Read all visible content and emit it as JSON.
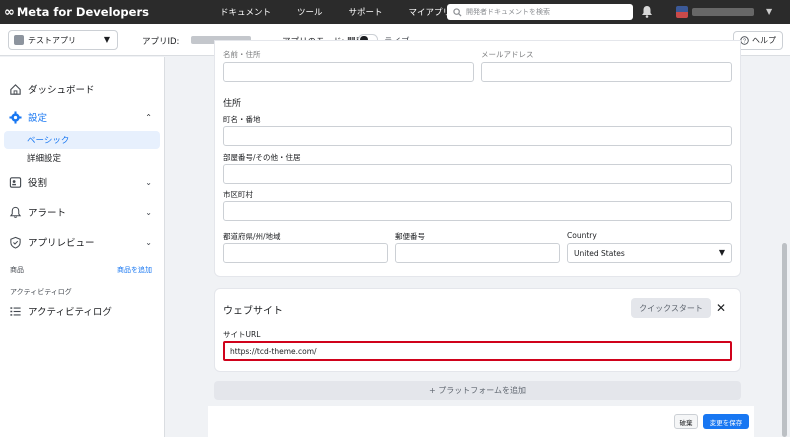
{
  "topbar": {
    "brand": "Meta for Developers",
    "nav": [
      "ドキュメント",
      "ツール",
      "サポート",
      "マイアプリ"
    ],
    "search_placeholder": "開発者ドキュメントを検索"
  },
  "appbar": {
    "app_name": "テストアプリ",
    "app_id_label": "アプリID:",
    "mode_label": "アプリのモード: 開発",
    "live_label": "ライブ",
    "help_label": "ヘルプ"
  },
  "sidebar": {
    "dashboard": "ダッシュボード",
    "settings": "設定",
    "basic": "ベーシック",
    "advanced": "詳細設定",
    "roles": "役割",
    "alerts": "アラート",
    "app_review": "アプリレビュー",
    "products_label": "商品",
    "add_product": "商品を追加",
    "activity_log_heading": "アクティビティログ",
    "activity_log": "アクティビティログ"
  },
  "form": {
    "top_label_left": "名前・住所",
    "top_label_right": "メールアドレス",
    "address_title": "住所",
    "street_label": "町名・番地",
    "apt_label": "部屋番号/その他・住居",
    "city_label": "市区町村",
    "state_label": "都道府県/州/地域",
    "zip_label": "郵便番号",
    "country_label": "Country",
    "country_value": "United States"
  },
  "website": {
    "title": "ウェブサイト",
    "quickstart": "クイックスタート",
    "url_label": "サイトURL",
    "url_value": "https://tcd-theme.com/"
  },
  "footer": {
    "add_platform": "+ プラットフォームを追加",
    "discard": "破棄",
    "save": "変更を保存"
  }
}
